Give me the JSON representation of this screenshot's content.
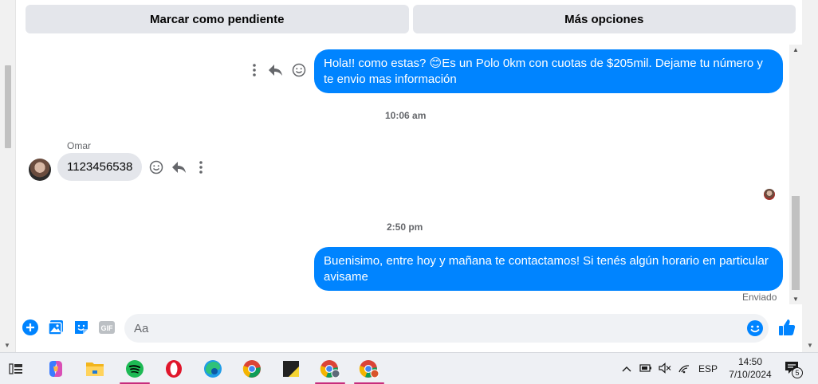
{
  "header": {
    "mark_pending_label": "Marcar como pendiente",
    "more_options_label": "Más opciones"
  },
  "messages": [
    {
      "direction": "outgoing",
      "text": "Hola!! como estas? 😊Es un Polo 0km con cuotas de $205mil. Dejame tu número y te envio mas información"
    },
    {
      "direction": "incoming",
      "sender": "Omar",
      "text": "1123456538"
    },
    {
      "direction": "outgoing",
      "text": "Buenisimo, entre hoy y mañana te contactamos! Si tenés algún horario en particular avisame"
    }
  ],
  "timestamps": [
    "10:06 am",
    "2:50 pm"
  ],
  "status": {
    "sent_label": "Enviado"
  },
  "composer": {
    "placeholder": "Aa"
  },
  "colors": {
    "accent": "#0084ff",
    "bubble_incoming": "#e4e6eb",
    "taskbar_bg": "#eef0f4",
    "taskbar_active_indicator": "#c72c7c"
  },
  "taskbar": {
    "apps": [
      {
        "name": "copilot-icon"
      },
      {
        "name": "file-explorer-icon"
      },
      {
        "name": "spotify-icon",
        "active": true
      },
      {
        "name": "opera-icon"
      },
      {
        "name": "edge-icon"
      },
      {
        "name": "chrome-icon"
      },
      {
        "name": "sticky-notes-icon"
      },
      {
        "name": "chrome-profile-icon",
        "active": true
      },
      {
        "name": "chrome-profile-2-icon",
        "active": true
      }
    ],
    "tray": {
      "language": "ESP",
      "time": "14:50",
      "date": "7/10/2024",
      "notification_count": "5"
    }
  }
}
